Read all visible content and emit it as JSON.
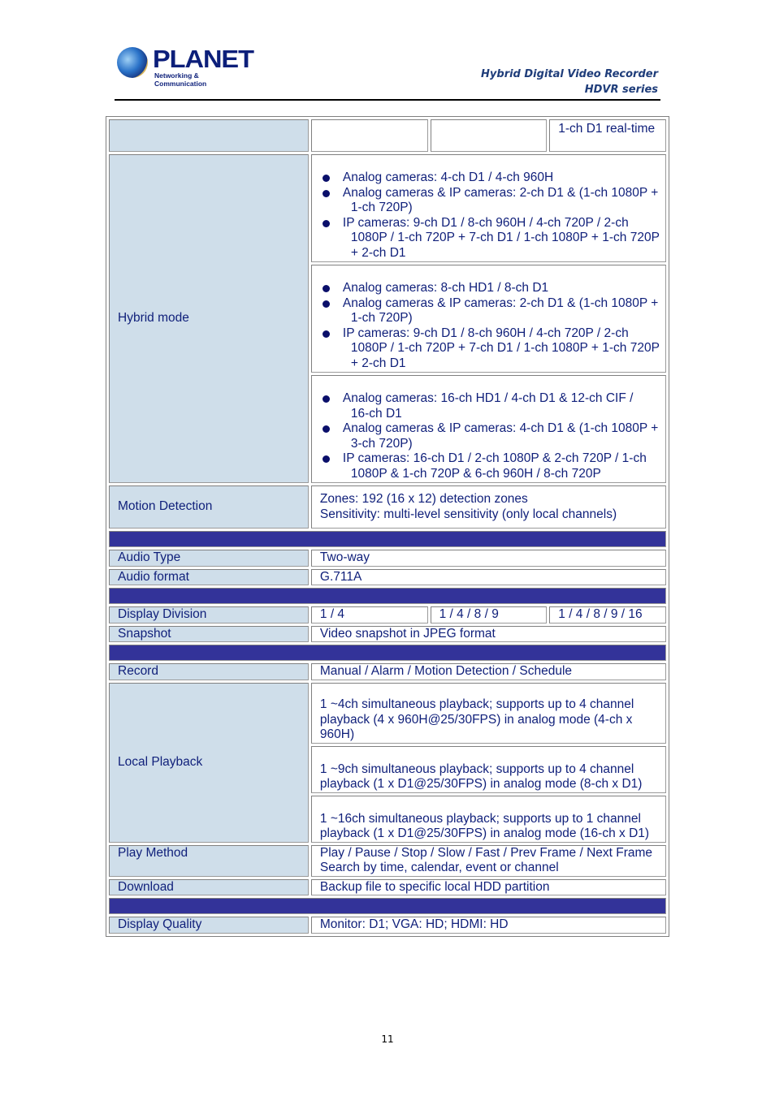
{
  "header": {
    "logo_name": "PLANET",
    "logo_tagline": "Networking & Communication",
    "doc_title_line1": "Hybrid Digital Video Recorder",
    "doc_title_line2": "HDVR series"
  },
  "table": {
    "top_row": {
      "label": "",
      "col1": "",
      "col2": "",
      "col3": "1-ch D1 real-time"
    },
    "hybrid_mode": {
      "label": "Hybrid mode",
      "groups": [
        {
          "items": [
            {
              "first": "Analog cameras: 4-ch D1 / 4-ch 960H",
              "rest": ""
            },
            {
              "first": "Analog cameras & IP cameras: 2-ch D1 & (1-ch 1080P +",
              "rest": "1-ch 720P)"
            },
            {
              "first": "IP cameras: 9-ch D1 / 8-ch 960H / 4-ch 720P / 2-ch",
              "rest": "1080P / 1-ch 720P + 7-ch D1 / 1-ch 1080P + 1-ch 720P + 2-ch D1"
            }
          ]
        },
        {
          "items": [
            {
              "first": "Analog cameras: 8-ch HD1 / 8-ch D1",
              "rest": ""
            },
            {
              "first": "Analog cameras & IP cameras: 2-ch D1 & (1-ch 1080P +",
              "rest": "1-ch 720P)"
            },
            {
              "first": "IP cameras: 9-ch D1 / 8-ch 960H / 4-ch 720P / 2-ch",
              "rest": "1080P / 1-ch 720P + 7-ch D1 / 1-ch 1080P + 1-ch 720P + 2-ch D1"
            }
          ]
        },
        {
          "items": [
            {
              "first": "Analog cameras: 16-ch HD1 / 4-ch D1 & 12-ch CIF /",
              "rest": "16-ch D1"
            },
            {
              "first": "Analog cameras & IP cameras: 4-ch D1 & (1-ch 1080P +",
              "rest": "3-ch 720P)"
            },
            {
              "first": "IP cameras: 16-ch D1 / 2-ch 1080P & 2-ch 720P / 1-ch",
              "rest": "1080P & 1-ch 720P & 6-ch 960H / 8-ch 720P"
            }
          ]
        }
      ]
    },
    "motion_detection": {
      "label": "Motion Detection",
      "line1": "Zones: 192 (16 x 12) detection zones",
      "line2": "Sensitivity: multi-level sensitivity (only local channels)"
    },
    "audio_type": {
      "label": "Audio Type",
      "value": "Two-way"
    },
    "audio_format": {
      "label": "Audio format",
      "value": "G.711A"
    },
    "display_division": {
      "label": "Display Division",
      "col1": "1 / 4",
      "col2": "1 / 4 / 8 / 9",
      "col3": "1 / 4 / 8 / 9 / 16"
    },
    "snapshot": {
      "label": "Snapshot",
      "value": "Video snapshot in JPEG format"
    },
    "record": {
      "label": "Record",
      "value": "Manual / Alarm / Motion Detection / Schedule"
    },
    "local_playback": {
      "label": "Local Playback",
      "values": [
        "1 ~4ch simultaneous playback; supports up to 4 channel playback (4 x 960H@25/30FPS) in analog mode (4-ch x 960H)",
        "1 ~9ch simultaneous playback; supports up to 4 channel playback (1 x D1@25/30FPS) in analog mode (8-ch x D1)",
        "1 ~16ch simultaneous playback; supports up to 1 channel playback (1 x D1@25/30FPS) in analog mode (16-ch x D1)"
      ]
    },
    "play_method": {
      "label": "Play Method",
      "line1": "Play / Pause / Stop / Slow / Fast / Prev Frame / Next Frame",
      "line2": "Search by time, calendar, event or channel"
    },
    "download": {
      "label": "Download",
      "value": "Backup file to specific local HDD partition"
    },
    "display_quality": {
      "label": "Display Quality",
      "value": "Monitor: D1; VGA: HD; HDMI: HD"
    }
  },
  "footer": {
    "page_number": "11"
  }
}
